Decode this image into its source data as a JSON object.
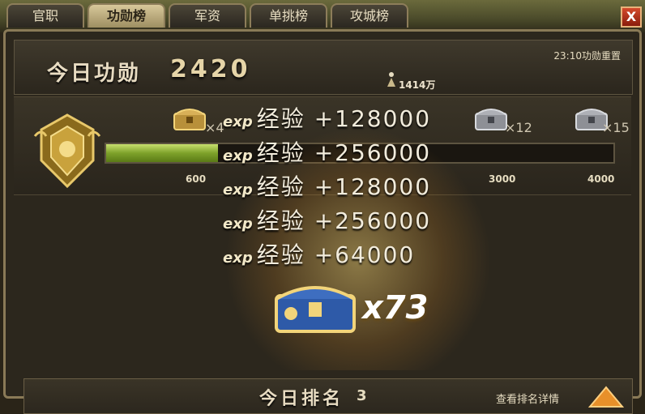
{
  "tabs": [
    {
      "label": "官职",
      "active": false
    },
    {
      "label": "功勋榜",
      "active": true
    },
    {
      "label": "军资",
      "active": false
    },
    {
      "label": "单挑榜",
      "active": false
    },
    {
      "label": "攻城榜",
      "active": false
    }
  ],
  "close_label": "X",
  "header": {
    "merit_label": "今日功勋",
    "merit_value": "2420",
    "reset_text": "23:10功勋重置",
    "resource_count": "1414万"
  },
  "progress": {
    "fraction": 0.22,
    "ticks": [
      "600",
      "3000",
      "4000"
    ],
    "node_counts": [
      "×4",
      "×12",
      "×15"
    ]
  },
  "rewards": [
    {
      "prefix": "exp",
      "text": "经验 +128000"
    },
    {
      "prefix": "exp",
      "text": "经验 +256000"
    },
    {
      "prefix": "exp",
      "text": "经验 +128000"
    },
    {
      "prefix": "exp",
      "text": "经验 +256000"
    },
    {
      "prefix": "exp",
      "text": "经验 +64000"
    }
  ],
  "chest": {
    "multiplier": "x73"
  },
  "bottom": {
    "rank_label": "今日排名",
    "rank_value": "3",
    "detail_link": "查看排名详情"
  },
  "colors": {
    "accent_gold": "#e6d5a8",
    "progress_green": "#7ea22a"
  }
}
